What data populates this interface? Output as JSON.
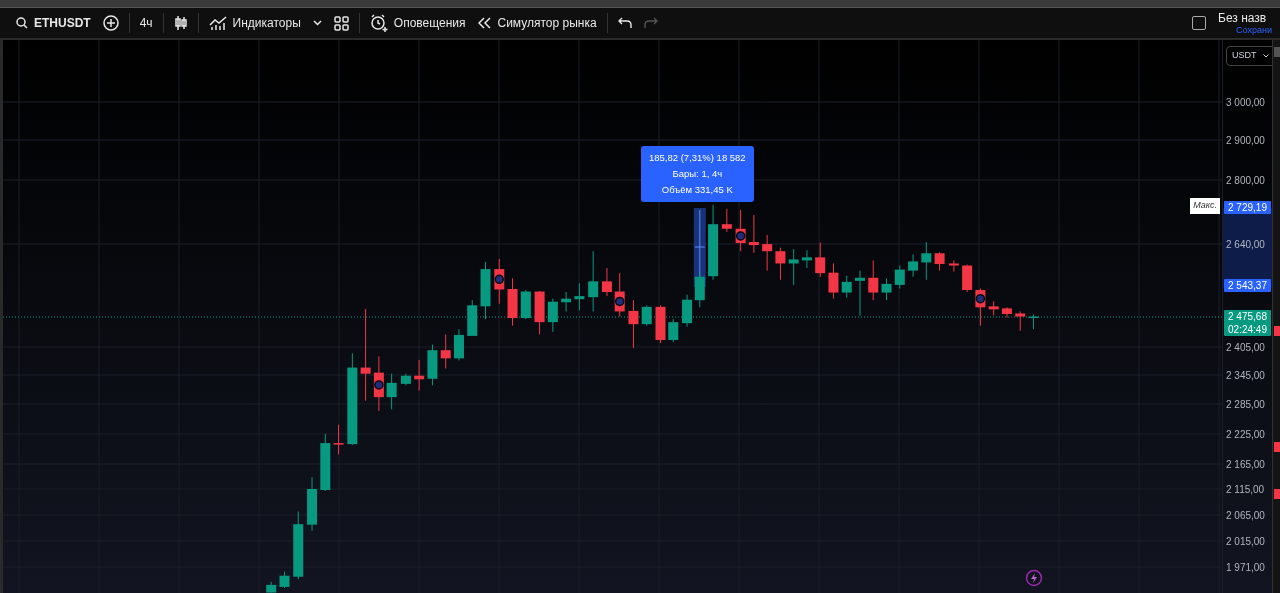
{
  "toolbar": {
    "symbol": "ETHUSDT",
    "interval": "4ч",
    "indicators": "Индикаторы",
    "alerts": "Оповещения",
    "replay": "Симулятор рынка",
    "undo_disabled": false,
    "redo_disabled": true
  },
  "layout": {
    "checked": false,
    "title": "Без назв",
    "status": "Сохрани"
  },
  "price_axis": {
    "currency": "USDT",
    "ticks": [
      "3 000,00",
      "2 900,00",
      "2 800,00",
      "2 640,00",
      "2 405,00",
      "2 345,00",
      "2 285,00",
      "2 225,00",
      "2 165,00",
      "2 115,00",
      "2 065,00",
      "2 015,00",
      "1 971,00"
    ]
  },
  "measure_tooltip": {
    "lines": [
      "185,82 (7,31%) 18 582",
      "Бары: 1, 4ч",
      "Объём 331,45 K"
    ]
  },
  "max_label": "Макс.",
  "price_tags": [
    {
      "kind": "range",
      "text": "2 729,19"
    },
    {
      "kind": "range",
      "text": "2 543,37"
    },
    {
      "kind": "last",
      "text": "2 475,68",
      "countdown": "02:24:49"
    }
  ]
}
